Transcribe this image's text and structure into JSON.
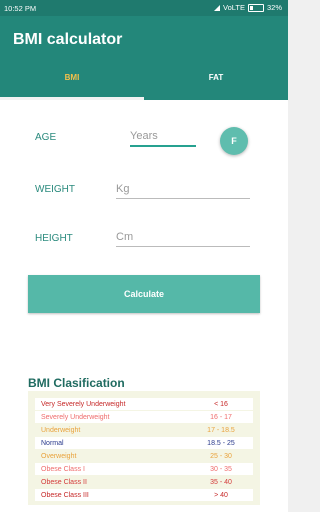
{
  "status_bar": {
    "time": "10:52 PM",
    "network": "VoLTE",
    "battery": "32%"
  },
  "app": {
    "title": "BMI calculator"
  },
  "tabs": [
    {
      "label": "BMI"
    },
    {
      "label": "FAT"
    }
  ],
  "form": {
    "age": {
      "label": "AGE",
      "placeholder": "Years"
    },
    "weight": {
      "label": "WEIGHT",
      "placeholder": "Kg"
    },
    "height": {
      "label": "HEIGHT",
      "placeholder": "Cm"
    },
    "gender_button": "F",
    "calculate_label": "Calculate"
  },
  "classification": {
    "title": "BMI Clasification",
    "rows": [
      {
        "name": "Very Severely Underweight",
        "range": "< 16",
        "color": "#c62828"
      },
      {
        "name": "Severely Underweight",
        "range": "16 - 17",
        "color": "#ef6c6c"
      },
      {
        "name": "Underweight",
        "range": "17 - 18.5",
        "color": "#e9a23b"
      },
      {
        "name": "Normal",
        "range": "18.5 - 25",
        "color": "#2a3a8c"
      },
      {
        "name": "Overweight",
        "range": "25 - 30",
        "color": "#e9a23b"
      },
      {
        "name": "Obese Class I",
        "range": "30 - 35",
        "color": "#ef6c6c"
      },
      {
        "name": "Obese Class II",
        "range": "35 - 40",
        "color": "#d33a3a"
      },
      {
        "name": "Obese Class III",
        "range": "> 40",
        "color": "#c62828"
      }
    ]
  }
}
